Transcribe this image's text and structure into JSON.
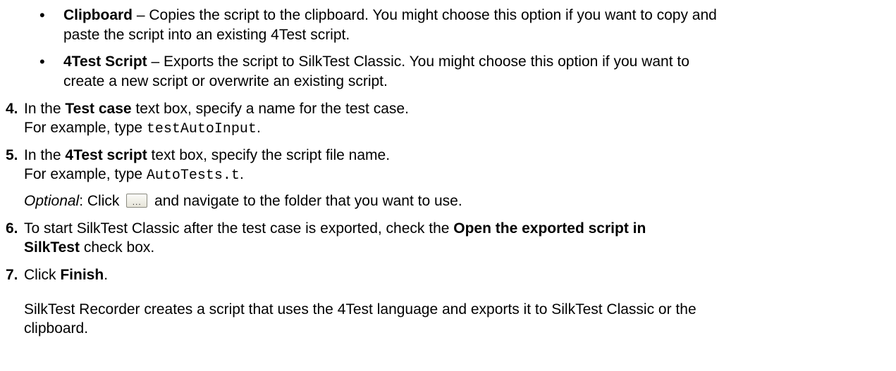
{
  "bullets": [
    {
      "term": "Clipboard",
      "line1": " – Copies the script to the clipboard. You might choose this option if you want to copy and",
      "line2": "paste the script into an existing 4Test script."
    },
    {
      "term": "4Test Script",
      "line1": " – Exports the script to SilkTest Classic. You might choose this option if you want to",
      "line2": "create a new script or overwrite an existing script."
    }
  ],
  "steps": {
    "s4": {
      "num": "4.",
      "pre": "In the ",
      "bold": "Test case",
      "post": " text box, specify a name for the test case.",
      "ex_pre": "For example, type ",
      "ex_code": "testAutoInput",
      "ex_post": "."
    },
    "s5": {
      "num": "5.",
      "pre": "In the ",
      "bold": "4Test script",
      "post": " text box, specify the script file name.",
      "ex_pre": "For example, type ",
      "ex_code": "AutoTests.t",
      "ex_post": ".",
      "optional_label": "Optional",
      "optional_pre": ": Click ",
      "optional_button": "...",
      "optional_post": " and navigate to the folder that you want to use."
    },
    "s6": {
      "num": "6.",
      "pre": "To start SilkTest Classic after the test case is exported, check the ",
      "bold1": "Open the exported script in",
      "bold2": "SilkTest",
      "post": " check box."
    },
    "s7": {
      "num": "7.",
      "pre": "Click ",
      "bold": "Finish",
      "post": "."
    }
  },
  "result": {
    "line1": "SilkTest Recorder creates a script that uses the 4Test language and exports it to SilkTest Classic or the",
    "line2": "clipboard."
  }
}
